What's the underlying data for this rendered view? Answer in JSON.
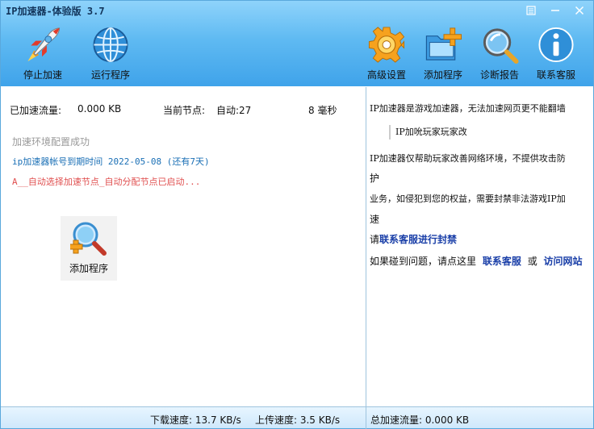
{
  "window": {
    "title": "IP加速器-体验版 3.7"
  },
  "toolbar": {
    "stop_accel": "停止加速",
    "run_program": "运行程序",
    "advanced_settings": "高级设置",
    "add_program": "添加程序",
    "diagnostic_report": "诊断报告",
    "contact_support": "联系客服"
  },
  "stats": {
    "accel_traffic_label": "已加速流量:",
    "accel_traffic_value": "0.000 KB",
    "current_node_label": "当前节点:",
    "current_node_value": "自动:27",
    "latency": "8 毫秒"
  },
  "log": {
    "line1": "加速环境配置成功",
    "line2": "ip加速器帐号到期时间 2022-05-08 (还有7天)",
    "line3": "A__自动选择加速节点_自动分配节点已启动..."
  },
  "add_program_tile": {
    "label": "添加程序"
  },
  "notice": {
    "line1": "IP加速器是游戏加速器，无法加速网页更不能翻墙",
    "quote": "IP加吮玩家玩家改",
    "line2": "IP加速器仅帮助玩家改善网络环境，不提供攻击防",
    "line3": "护",
    "line4": "业务，如侵犯到您的权益，需要封禁非法游戏IP加",
    "line5": "速",
    "line6_prefix": "请",
    "line6_link": "联系客服进行封禁",
    "line7_prefix": "如果碰到问题，请点这里",
    "line7_link1": "联系客服",
    "line7_or": "或",
    "line7_link2": "访问网站"
  },
  "statusbar": {
    "download": "下载速度: 13.7 KB/s",
    "upload": "上传速度: 3.5 KB/s",
    "total": "总加速流量: 0.000 KB"
  },
  "colors": {
    "toolbar_top": "#8fd3fb",
    "toolbar_bottom": "#3fa3ea",
    "link_blue": "#1a3fa8",
    "log_red": "#e05050",
    "log_blue": "#1a6fb5"
  },
  "icons": {
    "stop_accel": "rocket-icon",
    "run_program": "globe-icon",
    "advanced_settings": "gear-icon",
    "add_program": "folder-plus-icon",
    "diagnostic_report": "magnifier-icon",
    "contact_support": "info-icon"
  }
}
